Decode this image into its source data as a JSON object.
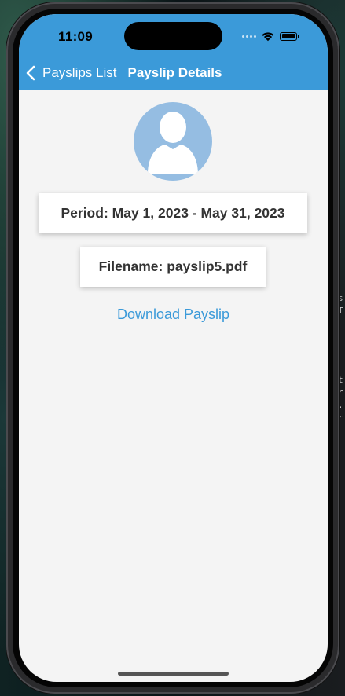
{
  "status_bar": {
    "time": "11:09",
    "wifi_icon": "wifi-icon",
    "battery_icon": "battery-icon"
  },
  "nav": {
    "back_label": "Payslips List",
    "back_icon": "chevron-left-icon",
    "title": "Payslip Details",
    "color": "#3b9ad9"
  },
  "profile": {
    "avatar_icon": "person-silhouette-icon",
    "avatar_color": "#95bde2"
  },
  "payslip": {
    "period": "Period: May 1, 2023 - May 31, 2023",
    "filename": "Filename: payslip5.pdf"
  },
  "actions": {
    "download_label": "Download Payslip"
  },
  "background_window": {
    "glyphs": [
      "s",
      "T",
      "",
      "",
      "",
      "",
      "t.",
      "r",
      ".",
      "r"
    ]
  }
}
